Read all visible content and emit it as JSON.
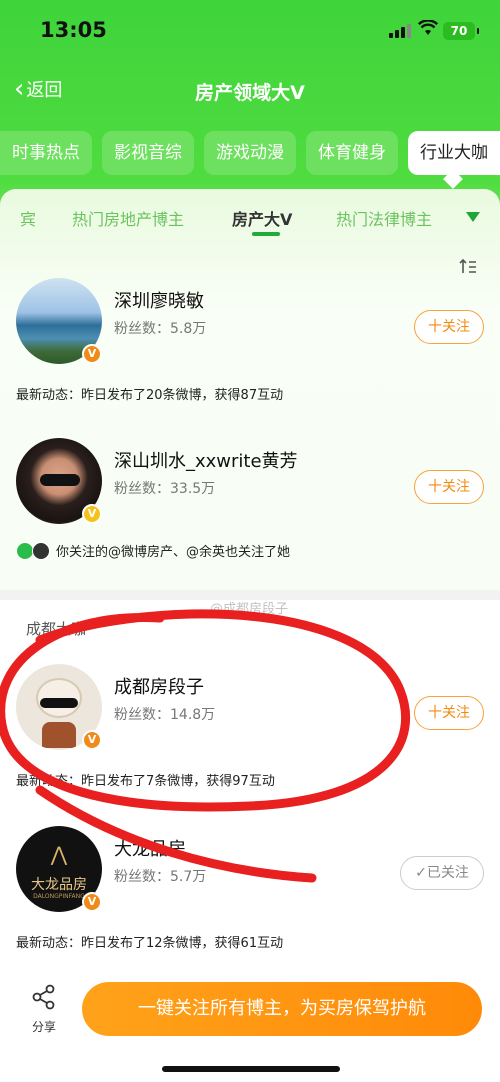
{
  "status_bar": {
    "time": "13:05",
    "battery": "70"
  },
  "navbar": {
    "back_label": "返回",
    "title": "房产领域大V"
  },
  "categories": [
    {
      "label": "时事热点"
    },
    {
      "label": "影视音综"
    },
    {
      "label": "游戏动漫"
    },
    {
      "label": "体育健身"
    },
    {
      "label": "行业大咖"
    }
  ],
  "subtabs": [
    {
      "label": "宾"
    },
    {
      "label": "热门房地产博主"
    },
    {
      "label": "房产大V"
    },
    {
      "label": "热门法律博主"
    }
  ],
  "users": [
    {
      "name": "深圳廖晓敏",
      "fans": "粉丝数：5.8万",
      "follow_label": "十关注",
      "activity": "最新动态：昨日发布了20条微博，获得87互动"
    },
    {
      "name": "深山圳水_xxwrite黄芳",
      "fans": "粉丝数：33.5万",
      "follow_label": "十关注",
      "mutual": "你关注的@微博房产、@余英也关注了她"
    }
  ],
  "group2": {
    "title": "成都大咖",
    "users": [
      {
        "name": "成都房段子",
        "fans": "粉丝数：14.8万",
        "follow_label": "十关注",
        "activity": "最新动态：昨日发布了7条微博，获得97互动"
      },
      {
        "name": "大龙品房",
        "fans": "粉丝数：5.7万",
        "follow_label": "✓已关注",
        "activity": "最新动态：昨日发布了12条微博，获得61互动",
        "avatar_text": "大龙品房",
        "avatar_sub": "DALONGPINFANG"
      }
    ]
  },
  "watermark": "@成都房段子",
  "bottom": {
    "share_label": "分享",
    "cta_label": "一键关注所有博主，为买房保驾护航"
  },
  "colors": {
    "green": "#3fd43b",
    "orange": "#ff9a10",
    "badge_orange": "#f08a18",
    "badge_yellow": "#f5c21a"
  },
  "icons": [
    "signal-icon",
    "wifi-icon",
    "battery-icon",
    "chevron-left-icon",
    "chevron-down-icon",
    "sort-icon",
    "verified-badge-icon",
    "share-icon"
  ]
}
